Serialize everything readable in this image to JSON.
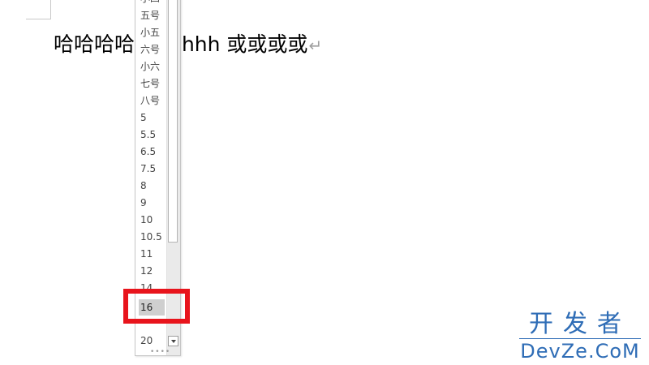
{
  "document": {
    "text": "哈哈哈哈哈哈 hhh 或或或或",
    "paragraph_mark": "↵"
  },
  "font_size_dropdown": {
    "items": [
      "小四",
      "五号",
      "小五",
      "六号",
      "小六",
      "七号",
      "八号",
      "5",
      "5.5",
      "6.5",
      "7.5",
      "8",
      "9",
      "10",
      "10.5",
      "11",
      "12",
      "14",
      "16",
      "20"
    ],
    "selected": "16"
  },
  "watermark": {
    "cn": "开发者",
    "en": "DevZe.CoM"
  },
  "colors": {
    "highlight": "#e8141c",
    "watermark": "#2f6db6"
  }
}
